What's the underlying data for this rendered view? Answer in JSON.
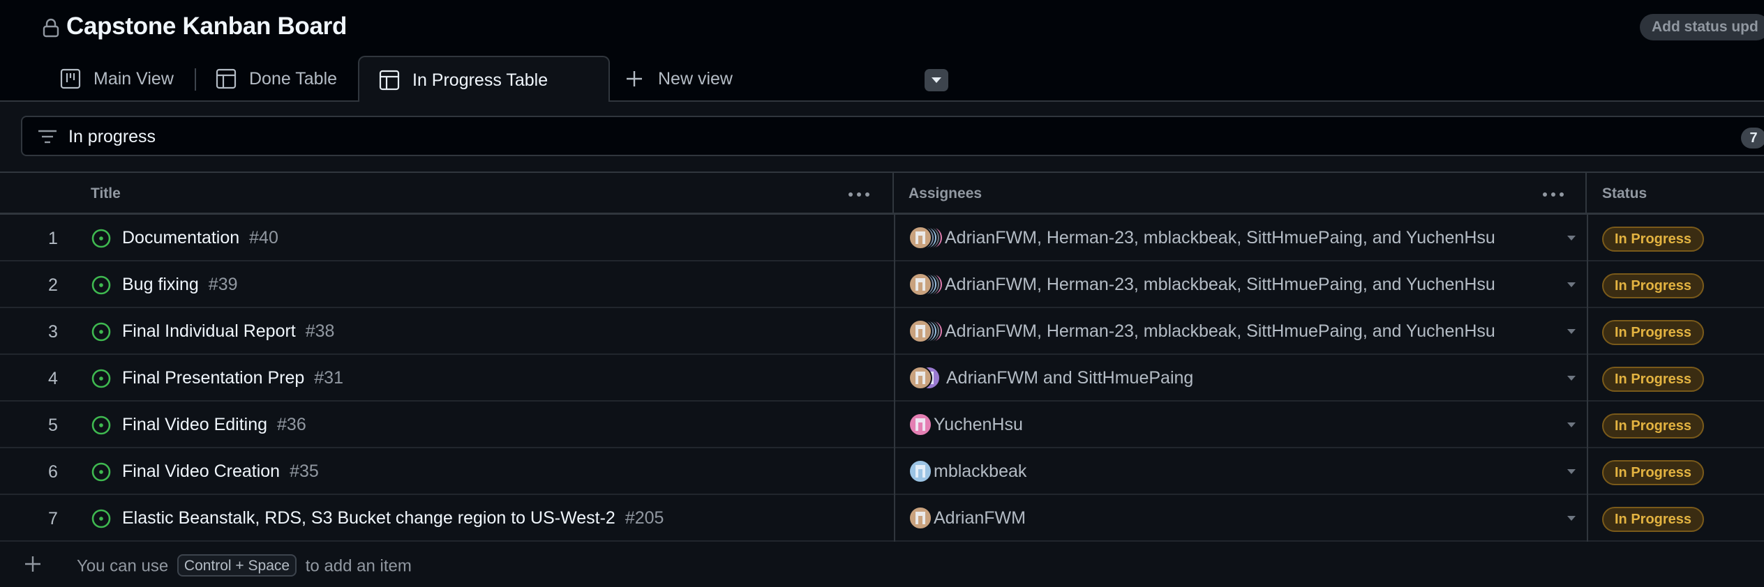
{
  "header": {
    "title": "Capstone Kanban Board",
    "status_update_button": "Add status upd"
  },
  "tabs": [
    {
      "label": "Main View",
      "icon": "board-icon"
    },
    {
      "label": "Done Table",
      "icon": "table-icon"
    },
    {
      "label": "In Progress Table",
      "icon": "table-icon",
      "active": true
    },
    {
      "label": "New view",
      "icon": "plus-icon"
    }
  ],
  "filter": {
    "query": "In progress",
    "count": "7"
  },
  "columns": {
    "title": "Title",
    "assignees": "Assignees",
    "status": "Status"
  },
  "rows": [
    {
      "num": "1",
      "title": "Documentation",
      "issue": "#40",
      "assignees": "AdrianFWM, Herman-23, mblackbeak, SittHmuePaing, and YuchenHsu",
      "status": "In Progress"
    },
    {
      "num": "2",
      "title": "Bug fixing",
      "issue": "#39",
      "assignees": "AdrianFWM, Herman-23, mblackbeak, SittHmuePaing, and YuchenHsu",
      "status": "In Progress"
    },
    {
      "num": "3",
      "title": "Final Individual Report",
      "issue": "#38",
      "assignees": "AdrianFWM, Herman-23, mblackbeak, SittHmuePaing, and YuchenHsu",
      "status": "In Progress"
    },
    {
      "num": "4",
      "title": "Final Presentation Prep",
      "issue": "#31",
      "assignees": "AdrianFWM and SittHmuePaing",
      "status": "In Progress"
    },
    {
      "num": "5",
      "title": "Final Video Editing",
      "issue": "#36",
      "assignees": "YuchenHsu",
      "status": "In Progress"
    },
    {
      "num": "6",
      "title": "Final Video Creation",
      "issue": "#35",
      "assignees": "mblackbeak",
      "status": "In Progress"
    },
    {
      "num": "7",
      "title": "Elastic Beanstalk, RDS, S3 Bucket change region to US-West-2",
      "issue": "#205",
      "assignees": "AdrianFWM",
      "status": "In Progress"
    }
  ],
  "add_item": {
    "prefix": "You can use",
    "shortcut": "Control + Space",
    "suffix": "to add an item"
  },
  "colors": {
    "open_issue": "#3fb950",
    "status_text": "#e3b341",
    "status_bg": "#3a2c12"
  }
}
